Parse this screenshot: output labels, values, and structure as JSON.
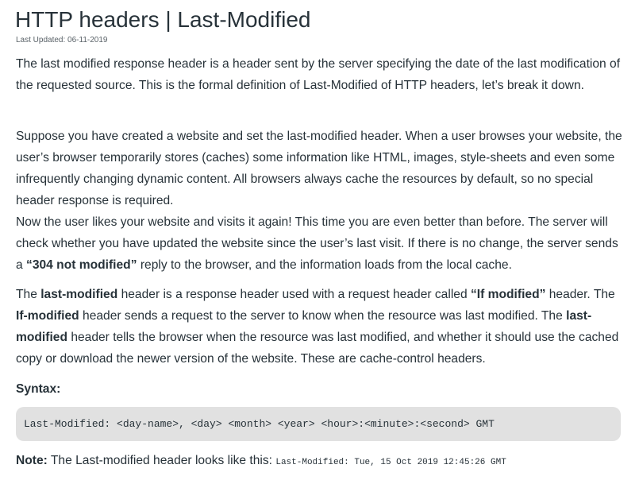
{
  "article": {
    "title": "HTTP headers | Last-Modified",
    "last_updated": "Last Updated: 06-11-2019",
    "p1": "The last modified response header is a header sent by the server specifying the date of the last modification of the requested source. This is the formal definition of Last-Modified of HTTP headers, let’s break it down.",
    "p2": {
      "s1": "Suppose you have created a website and set the last-modified header. When a user browses your website, the user’s browser temporarily stores (caches) some information like HTML, images, style-sheets and even some infrequently changing dynamic content. All browsers always cache the resources by default, so no special header response is required.",
      "s2": "Now the user likes your website and visits it again! This time you are even better than before. The server will check whether you have updated the website since the user’s last visit. If there is no change, the server sends a ",
      "b1": "“304 not modified”",
      "s3": " reply to the browser, and the information loads from the local cache."
    },
    "p3": {
      "t1": "The ",
      "b1": "last-modified",
      "t2": " header is a response header used with a request header called ",
      "b2": "“If modified”",
      "t3": " header. The ",
      "b3": "If-modified",
      "t4": " header sends a request to the server to know when the resource was last modified. The ",
      "b4": "last-modified",
      "t5": " header tells the browser when the resource was last modified, and whether it should use the cached copy or download the newer version of the website. These are cache-control headers."
    },
    "syntax_label": "Syntax:",
    "syntax_code": "Last-Modified: <day-name>, <day> <month> <year> <hour>:<minute>:<second> GMT",
    "note": {
      "label": "Note:",
      "text": " The Last-modified header looks like this: ",
      "code": "Last-Modified: Tue, 15 Oct 2019 12:45:26 GMT"
    }
  }
}
